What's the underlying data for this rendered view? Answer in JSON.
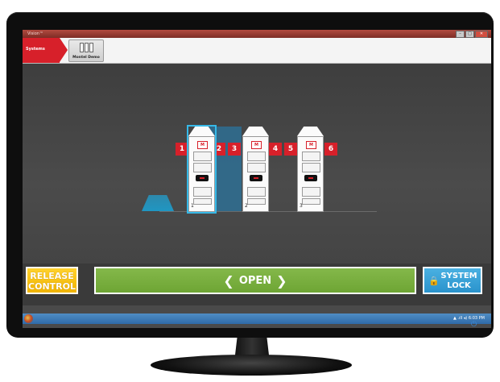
{
  "window": {
    "title": "Vision™",
    "controls": [
      "–",
      "□",
      "✕"
    ]
  },
  "ribbon": {
    "systems_tab": "Systems",
    "demo_tab": "Montel Demo"
  },
  "system": {
    "cabinets": [
      {
        "label": "1",
        "logo": "M"
      },
      {
        "label": "2",
        "logo": "M"
      },
      {
        "label": "3",
        "logo": "M"
      }
    ],
    "aisle_numbers": [
      "1",
      "2",
      "3",
      "4",
      "5",
      "6"
    ],
    "open_aisle_color": "#2e6f93",
    "selected_color": "#36b9e8"
  },
  "actions": {
    "release_line1": "RELEASE",
    "release_line2": "CONTROL",
    "open_label": "OPEN",
    "lock_line1": "SYSTEM",
    "lock_line2": "LOCK"
  },
  "taskbar": {
    "tray_time": "6:03 PM"
  },
  "colors": {
    "brand_red": "#d7202a",
    "release_yellow": "#f0b400",
    "open_green": "#6ea534",
    "lock_blue": "#2a93cc"
  }
}
